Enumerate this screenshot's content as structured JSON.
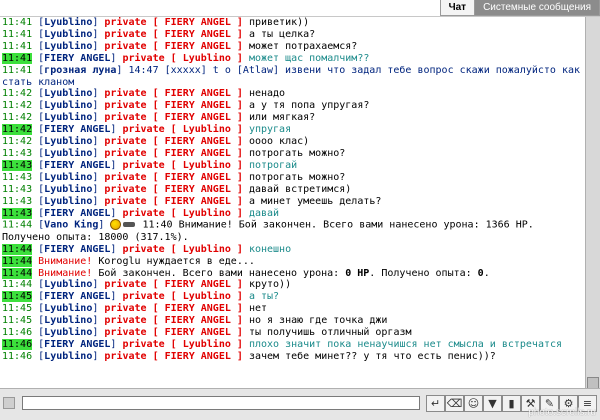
{
  "tabs": [
    {
      "label": "Чат",
      "active": true
    },
    {
      "label": "Системные сообщения",
      "active": false
    }
  ],
  "colors": {
    "time": "#008000",
    "time_highlight": "#3ce03c",
    "private": "#e10000",
    "nick": "#00247e",
    "reply_message": "#1a8a8a"
  },
  "lines": [
    {
      "time": "11:41",
      "hl": false,
      "sender": "Lyublino",
      "target": "FIERY ANGEL",
      "text": "приветик))",
      "alt": false
    },
    {
      "time": "11:41",
      "hl": false,
      "sender": "Lyublino",
      "target": "FIERY ANGEL",
      "text": "а ты целка?",
      "alt": false
    },
    {
      "time": "11:41",
      "hl": false,
      "sender": "Lyublino",
      "target": "FIERY ANGEL",
      "text": "может потрахаемся?",
      "alt": false
    },
    {
      "time": "11:41",
      "hl": true,
      "sender": "FIERY ANGEL",
      "target": "Lyublino",
      "text": "может щас помалчим??",
      "alt": true
    },
    {
      "kind": "room",
      "time": "11:41",
      "sender": "грозная луна",
      "text": "14:47 [xxxxx] t o [Atlaw] извени что задал тебе вопрос скажи пожалуйсто как стать кланом"
    },
    {
      "time": "11:42",
      "hl": false,
      "sender": "Lyublino",
      "target": "FIERY ANGEL",
      "text": "ненадо",
      "alt": false
    },
    {
      "time": "11:42",
      "hl": false,
      "sender": "Lyublino",
      "target": "FIERY ANGEL",
      "text": "а у тя попа упругая?",
      "alt": false
    },
    {
      "time": "11:42",
      "hl": false,
      "sender": "Lyublino",
      "target": "FIERY ANGEL",
      "text": "или мягкая?",
      "alt": false
    },
    {
      "time": "11:42",
      "hl": true,
      "sender": "FIERY ANGEL",
      "target": "Lyublino",
      "text": "упругая",
      "alt": true
    },
    {
      "time": "11:42",
      "hl": false,
      "sender": "Lyublino",
      "target": "FIERY ANGEL",
      "text": "оооо клас)",
      "alt": false
    },
    {
      "time": "11:43",
      "hl": false,
      "sender": "Lyublino",
      "target": "FIERY ANGEL",
      "text": "потрогать можно?",
      "alt": false
    },
    {
      "time": "11:43",
      "hl": true,
      "sender": "FIERY ANGEL",
      "target": "Lyublino",
      "text": "потрогай",
      "alt": true
    },
    {
      "time": "11:43",
      "hl": false,
      "sender": "Lyublino",
      "target": "FIERY ANGEL",
      "text": "потрогать можно?",
      "alt": false
    },
    {
      "time": "11:43",
      "hl": false,
      "sender": "Lyublino",
      "target": "FIERY ANGEL",
      "text": "давай встретимся)",
      "alt": false
    },
    {
      "time": "11:43",
      "hl": false,
      "sender": "Lyublino",
      "target": "FIERY ANGEL",
      "text": "а минет умеешь делать?",
      "alt": false
    },
    {
      "time": "11:43",
      "hl": true,
      "sender": "FIERY ANGEL",
      "target": "Lyublino",
      "text": "давай",
      "alt": true
    },
    {
      "kind": "battle",
      "time": "11:44",
      "sender": "Vano King",
      "text": "11:40 Внимание! Бой закончен. Всего вами нанесено урона: 1366 HP. Получено опыта: 18000 (317.1%)."
    },
    {
      "time": "11:44",
      "hl": true,
      "sender": "FIERY ANGEL",
      "target": "Lyublino",
      "text": "конешно",
      "alt": true
    },
    {
      "kind": "warn",
      "time": "11:44",
      "hl": true,
      "label": "Внимание!",
      "text": "Koroglu нуждается в еде..."
    },
    {
      "kind": "warnbold",
      "time": "11:44",
      "hl": true,
      "label": "Внимание!",
      "text": "Бой закончен. Всего вами нанесено урона: ",
      "b1": "0 HP",
      "mid": ". Получено опыта: ",
      "b2": "0",
      "end": "."
    },
    {
      "time": "11:44",
      "hl": false,
      "sender": "Lyublino",
      "target": "FIERY ANGEL",
      "text": "круто))",
      "alt": false
    },
    {
      "time": "11:45",
      "hl": true,
      "sender": "FIERY ANGEL",
      "target": "Lyublino",
      "text": "а ты?",
      "alt": true
    },
    {
      "time": "11:45",
      "hl": false,
      "sender": "Lyublino",
      "target": "FIERY ANGEL",
      "text": "нет",
      "alt": false
    },
    {
      "time": "11:45",
      "hl": false,
      "sender": "Lyublino",
      "target": "FIERY ANGEL",
      "text": "но я знаю где точка джи",
      "alt": false
    },
    {
      "time": "11:46",
      "hl": false,
      "sender": "Lyublino",
      "target": "FIERY ANGEL",
      "text": "ты получишь отличный оргазм",
      "alt": false
    },
    {
      "time": "11:46",
      "hl": true,
      "sender": "FIERY ANGEL",
      "target": "Lyublino",
      "text": "плохо значит пока ненаучишся нет смысла и встречатся",
      "alt": true
    },
    {
      "time": "11:46",
      "hl": false,
      "sender": "Lyublino",
      "target": "FIERY ANGEL",
      "text": "зачем тебе минет?? у тя что есть пенис))?",
      "alt": false
    }
  ],
  "private_label": "private",
  "input": {
    "value": "",
    "placeholder": ""
  },
  "toolbar": [
    {
      "name": "send-button",
      "icon": "↵"
    },
    {
      "name": "erase-button",
      "icon": "⌫"
    },
    {
      "name": "smiles-button",
      "icon": "☺"
    },
    {
      "name": "filter-button",
      "icon": "▼"
    },
    {
      "name": "bottle-button",
      "icon": "▮"
    },
    {
      "name": "tool-button",
      "icon": "⚒"
    },
    {
      "name": "sword-button",
      "icon": "✎"
    },
    {
      "name": "settings-button",
      "icon": "⚙"
    },
    {
      "name": "menu-button",
      "icon": "≡"
    }
  ],
  "watermark": "photo.scrolls.ru"
}
